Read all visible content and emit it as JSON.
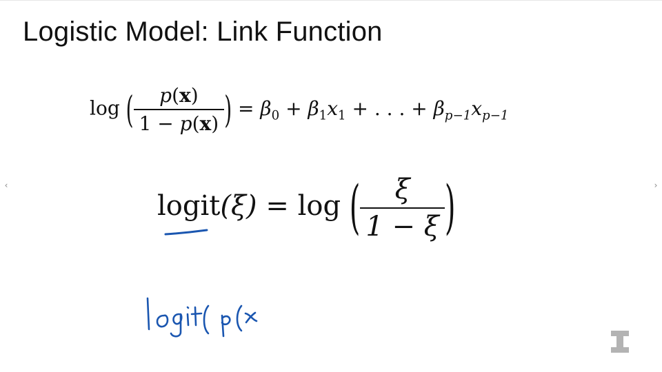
{
  "slide": {
    "title": "Logistic Model: Link Function"
  },
  "equation1": {
    "log": "log",
    "num_p": "p",
    "num_open": "(",
    "num_x": "x",
    "num_close": ")",
    "den_one_minus": "1 − ",
    "den_p": "p",
    "den_open": "(",
    "den_x": "x",
    "den_close": ")",
    "rhs_equals": " = ",
    "beta": "β",
    "sub_0": "0",
    "plus": " + ",
    "sub_1": "1",
    "x": "x",
    "ellipsis": " + . . . + ",
    "sub_p_minus_1": "p−1"
  },
  "equation2": {
    "logit": "logit",
    "arg": "(ξ)",
    "equals": " = ",
    "log": "log",
    "num": "ξ",
    "den": "1 − ξ"
  },
  "handwriting": {
    "text": "logit(p(x",
    "color": "#1a56b0"
  },
  "navigation": {
    "prev_icon": "chevron-left-icon",
    "next_icon": "chevron-right-icon",
    "prev_glyph": "‹",
    "next_glyph": "›"
  },
  "logo": {
    "icon": "illinois-block-i-logo",
    "color": "#b3b3b3"
  }
}
